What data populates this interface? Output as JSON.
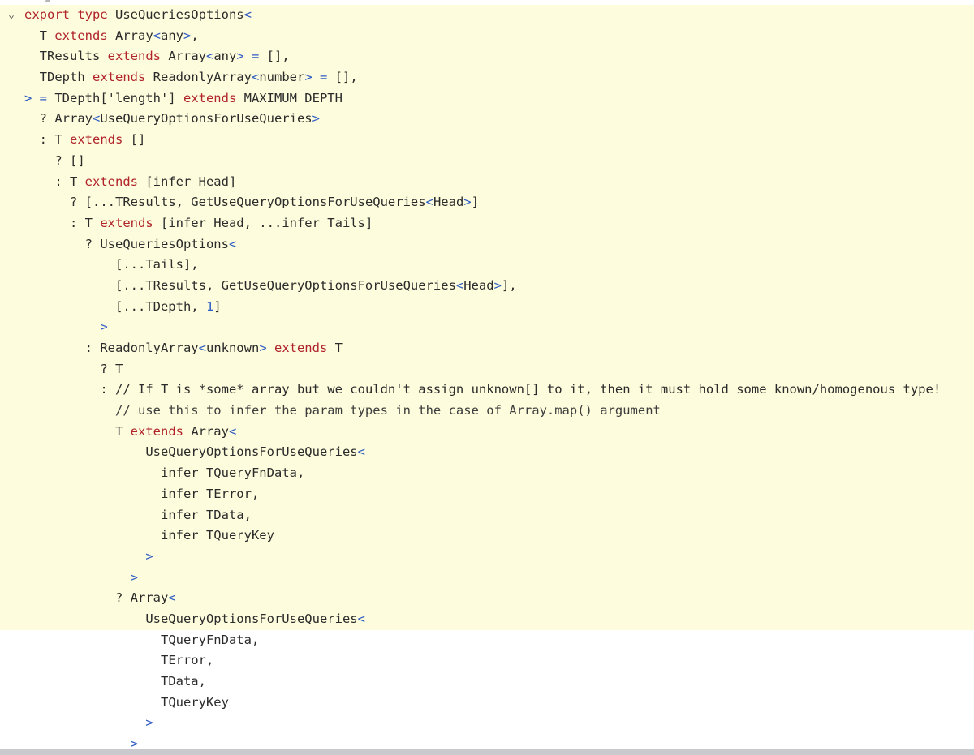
{
  "editor": {
    "fold_chevron": "⌄",
    "lines": [
      {
        "gutter": "⌄",
        "indent": 0,
        "tokens": [
          [
            "kw",
            "export type "
          ],
          [
            "id",
            "UseQueriesOptions"
          ],
          [
            "br",
            "<"
          ]
        ]
      },
      {
        "indent": 2,
        "tokens": [
          [
            "id",
            "T "
          ],
          [
            "kw",
            "extends "
          ],
          [
            "id",
            "Array"
          ],
          [
            "br",
            "<"
          ],
          [
            "id",
            "any"
          ],
          [
            "br",
            ">"
          ],
          [
            "id",
            ","
          ]
        ]
      },
      {
        "indent": 2,
        "tokens": [
          [
            "id",
            "TResults "
          ],
          [
            "kw",
            "extends "
          ],
          [
            "id",
            "Array"
          ],
          [
            "br",
            "<"
          ],
          [
            "id",
            "any"
          ],
          [
            "br",
            "> = "
          ],
          [
            "id",
            "[],"
          ]
        ]
      },
      {
        "indent": 2,
        "tokens": [
          [
            "id",
            "TDepth "
          ],
          [
            "kw",
            "extends "
          ],
          [
            "id",
            "ReadonlyArray"
          ],
          [
            "br",
            "<"
          ],
          [
            "id",
            "number"
          ],
          [
            "br",
            "> = "
          ],
          [
            "id",
            "[],"
          ]
        ]
      },
      {
        "indent": 0,
        "tokens": [
          [
            "br",
            "> = "
          ],
          [
            "id",
            "TDepth['length'] "
          ],
          [
            "kw",
            "extends "
          ],
          [
            "id",
            "MAXIMUM_DEPTH"
          ]
        ]
      },
      {
        "indent": 2,
        "tokens": [
          [
            "id",
            "? Array"
          ],
          [
            "br",
            "<"
          ],
          [
            "id",
            "UseQueryOptionsForUseQueries"
          ],
          [
            "br",
            ">"
          ]
        ]
      },
      {
        "indent": 2,
        "tokens": [
          [
            "id",
            ": T "
          ],
          [
            "kw",
            "extends "
          ],
          [
            "id",
            "[]"
          ]
        ]
      },
      {
        "indent": 4,
        "tokens": [
          [
            "id",
            "? []"
          ]
        ]
      },
      {
        "indent": 4,
        "tokens": [
          [
            "id",
            ": T "
          ],
          [
            "kw",
            "extends "
          ],
          [
            "id",
            "[infer Head]"
          ]
        ]
      },
      {
        "indent": 6,
        "tokens": [
          [
            "id",
            "? [...TResults, GetUseQueryOptionsForUseQueries"
          ],
          [
            "br",
            "<"
          ],
          [
            "id",
            "Head"
          ],
          [
            "br",
            ">"
          ],
          [
            "id",
            "]"
          ]
        ]
      },
      {
        "indent": 6,
        "tokens": [
          [
            "id",
            ": T "
          ],
          [
            "kw",
            "extends "
          ],
          [
            "id",
            "[infer Head, ...infer Tails]"
          ]
        ]
      },
      {
        "indent": 8,
        "tokens": [
          [
            "id",
            "? UseQueriesOptions"
          ],
          [
            "br",
            "<"
          ]
        ]
      },
      {
        "indent": 12,
        "tokens": [
          [
            "id",
            "[...Tails],"
          ]
        ]
      },
      {
        "indent": 12,
        "tokens": [
          [
            "id",
            "[...TResults, GetUseQueryOptionsForUseQueries"
          ],
          [
            "br",
            "<"
          ],
          [
            "id",
            "Head"
          ],
          [
            "br",
            ">"
          ],
          [
            "id",
            "],"
          ]
        ]
      },
      {
        "indent": 12,
        "tokens": [
          [
            "id",
            "[...TDepth, "
          ],
          [
            "num",
            "1"
          ],
          [
            "id",
            "]"
          ]
        ]
      },
      {
        "indent": 10,
        "tokens": [
          [
            "br",
            ">"
          ]
        ]
      },
      {
        "indent": 8,
        "tokens": [
          [
            "id",
            ": ReadonlyArray"
          ],
          [
            "br",
            "<"
          ],
          [
            "id",
            "unknown"
          ],
          [
            "br",
            "> "
          ],
          [
            "kw",
            "extends "
          ],
          [
            "id",
            "T"
          ]
        ]
      },
      {
        "indent": 10,
        "tokens": [
          [
            "id",
            "? T"
          ]
        ]
      },
      {
        "indent": 10,
        "tokens": [
          [
            "id",
            ": // If T is *some* array but we couldn't assign unknown[] to it, then it must hold some known/homogenous type!"
          ]
        ]
      },
      {
        "indent": 12,
        "tokens": [
          [
            "cm",
            "// use this to infer the param types in the case of Array.map() argument"
          ]
        ]
      },
      {
        "indent": 12,
        "tokens": [
          [
            "id",
            "T "
          ],
          [
            "kw",
            "extends "
          ],
          [
            "id",
            "Array"
          ],
          [
            "br",
            "<"
          ]
        ]
      },
      {
        "indent": 16,
        "tokens": [
          [
            "id",
            "UseQueryOptionsForUseQueries"
          ],
          [
            "br",
            "<"
          ]
        ]
      },
      {
        "indent": 18,
        "tokens": [
          [
            "id",
            "infer TQueryFnData,"
          ]
        ]
      },
      {
        "indent": 18,
        "tokens": [
          [
            "id",
            "infer TError,"
          ]
        ]
      },
      {
        "indent": 18,
        "tokens": [
          [
            "id",
            "infer TData,"
          ]
        ]
      },
      {
        "indent": 18,
        "tokens": [
          [
            "id",
            "infer TQueryKey"
          ]
        ]
      },
      {
        "indent": 16,
        "tokens": [
          [
            "br",
            ">"
          ]
        ]
      },
      {
        "indent": 14,
        "tokens": [
          [
            "br",
            ">"
          ]
        ]
      },
      {
        "indent": 12,
        "tokens": [
          [
            "id",
            "? Array"
          ],
          [
            "br",
            "<"
          ]
        ]
      },
      {
        "indent": 16,
        "tokens": [
          [
            "id",
            "UseQueryOptionsForUseQueries"
          ],
          [
            "br",
            "<"
          ]
        ]
      },
      {
        "indent": 18,
        "tokens": [
          [
            "id",
            "TQueryFnData,"
          ]
        ]
      },
      {
        "indent": 18,
        "tokens": [
          [
            "id",
            "TError,"
          ]
        ]
      },
      {
        "indent": 18,
        "tokens": [
          [
            "id",
            "TData,"
          ]
        ]
      },
      {
        "indent": 18,
        "tokens": [
          [
            "id",
            "TQueryKey"
          ]
        ]
      },
      {
        "indent": 16,
        "tokens": [
          [
            "br",
            ">"
          ]
        ]
      },
      {
        "indent": 14,
        "tokens": [
          [
            "br",
            ">"
          ]
        ]
      }
    ]
  },
  "colors": {
    "highlight_bg": "#fdfcdc",
    "keyword": "#b0232b",
    "bracket": "#2f5cc4",
    "identifier": "#2b2b2b"
  }
}
